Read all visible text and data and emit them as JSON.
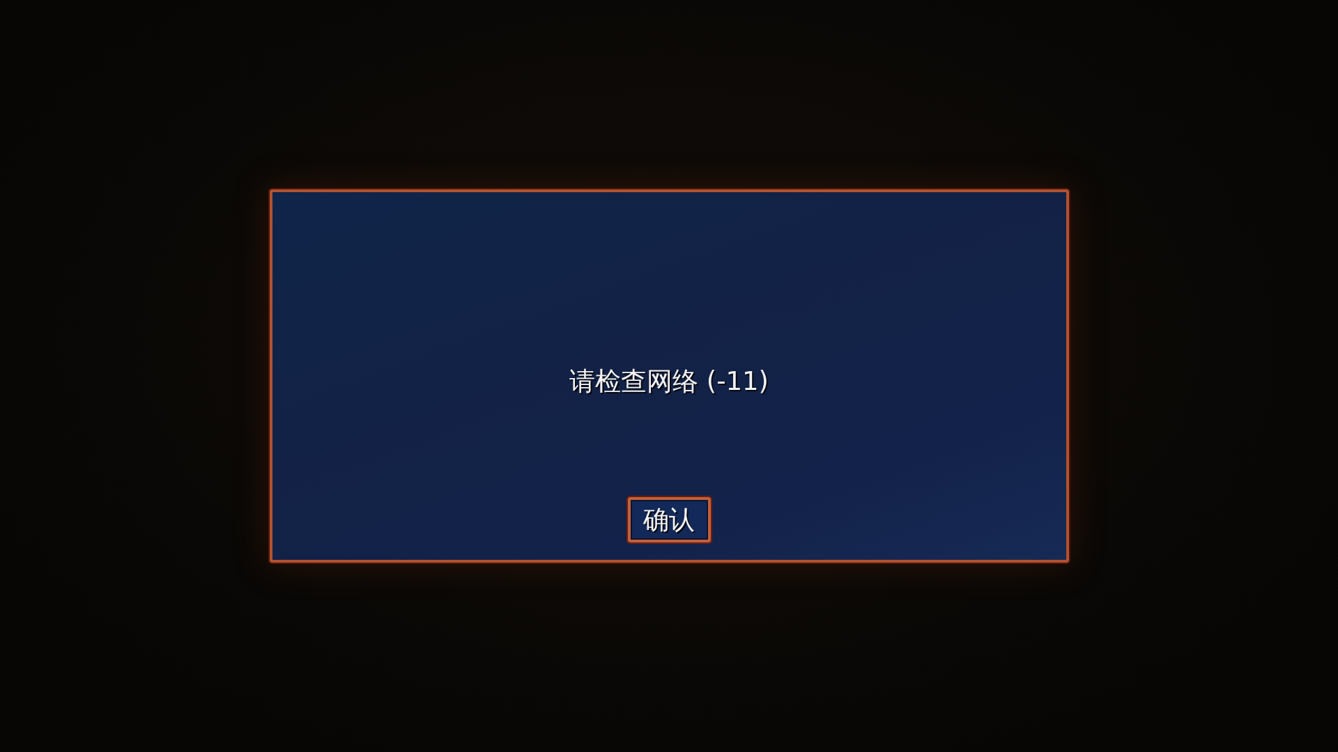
{
  "dialog": {
    "message": "请检查网络 (-11)",
    "buttons": [
      {
        "label": "确认"
      }
    ]
  }
}
